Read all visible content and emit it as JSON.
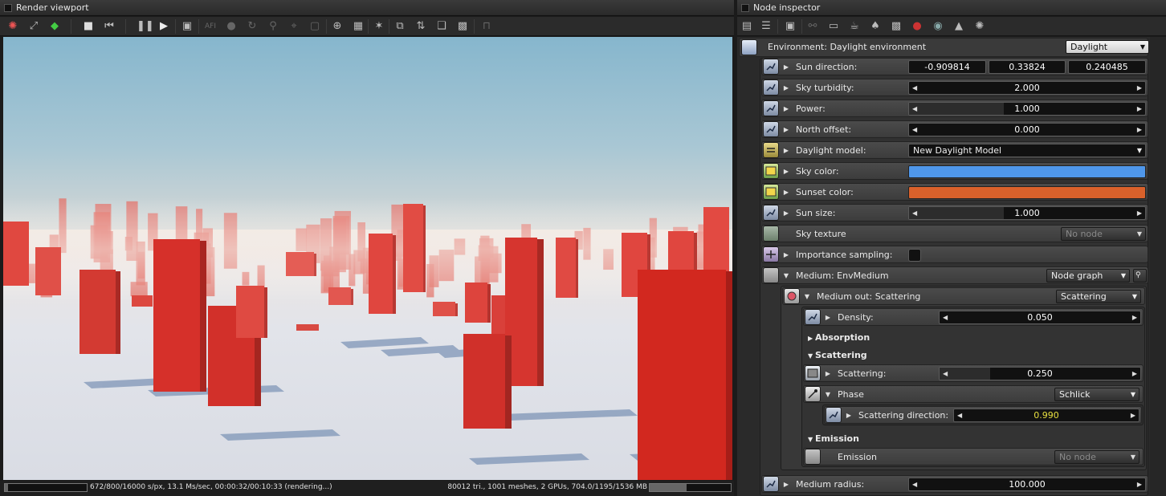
{
  "viewport": {
    "title": "Render viewport",
    "toolbar_icons": [
      "refresh-icon",
      "fit-icon",
      "cube-icon",
      "stop-icon",
      "rewind-icon",
      "pause-icon",
      "play-icon",
      "screen-icon",
      "afi-icon",
      "color-icon",
      "sync-icon",
      "lock-icon",
      "lock2-icon",
      "pick-icon",
      "zoom-region-icon",
      "region-icon",
      "pick-focus-icon",
      "copy-icon",
      "sync-camera-icon",
      "clay-icon",
      "checker-icon",
      "lock-render-icon"
    ],
    "toolbar_afi_text": "AFI",
    "status_left": "672/800/16000 s/px, 13.1 Ms/sec, 00:00:32/00:10:33 (rendering...)",
    "status_right": "80012 tri., 1001 meshes, 2 GPUs, 704.0/1195/1536 MB",
    "progress": 0.04,
    "memory_usage": 0.46
  },
  "inspector": {
    "title": "Node inspector",
    "toolbar_icons": [
      "stack-icon",
      "stack2-icon",
      "image-icon",
      "link-icon",
      "monitor-icon",
      "teapot-icon",
      "drop-icon",
      "texture-icon",
      "sphere-icon",
      "sphere2-icon",
      "picture-icon",
      "sun-icon"
    ],
    "environment": {
      "label": "Environment: Daylight environment",
      "value": "Daylight"
    },
    "sun_direction": {
      "label": "Sun direction:",
      "x": "-0.909814",
      "y": "0.33824",
      "z": "0.240485"
    },
    "sky_turbidity": {
      "label": "Sky turbidity:",
      "value": "2.000",
      "fill": 0.0
    },
    "power": {
      "label": "Power:",
      "value": "1.000",
      "fill": 0.4
    },
    "north_offset": {
      "label": "North offset:",
      "value": "0.000",
      "fill": 0.0
    },
    "daylight_model": {
      "label": "Daylight model:",
      "value": "New Daylight Model"
    },
    "sky_color": {
      "label": "Sky color:",
      "color": "#4f97ea"
    },
    "sunset_color": {
      "label": "Sunset color:",
      "color": "#d9612b"
    },
    "sun_size": {
      "label": "Sun size:",
      "value": "1.000",
      "fill": 0.4
    },
    "sky_texture": {
      "label": "Sky texture",
      "value": "No node"
    },
    "importance_sampling": {
      "label": "Importance sampling:"
    },
    "medium": {
      "label": "Medium: EnvMedium",
      "value": "Node graph"
    },
    "medium_out": {
      "label": "Medium out: Scattering",
      "value": "Scattering"
    },
    "density": {
      "label": "Density:",
      "value": "0.050",
      "fill": 0.0
    },
    "absorption": {
      "label": "Absorption"
    },
    "scattering_section": {
      "label": "Scattering"
    },
    "scattering": {
      "label": "Scattering:",
      "value": "0.250",
      "fill": 0.25
    },
    "phase": {
      "label": "Phase",
      "value": "Schlick"
    },
    "scattering_direction": {
      "label": "Scattering direction:",
      "value": "0.990",
      "fill": 0.0,
      "value_color": "#e8e040"
    },
    "emission_section": {
      "label": "Emission"
    },
    "emission": {
      "label": "Emission",
      "value": "No node"
    },
    "medium_radius": {
      "label": "Medium radius:",
      "value": "100.000",
      "fill": 0.0
    }
  }
}
